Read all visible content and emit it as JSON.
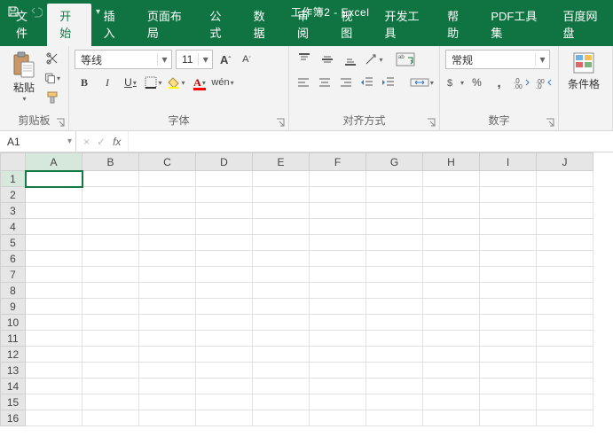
{
  "title": "工作簿2 - Excel",
  "tabs": [
    "文件",
    "开始",
    "插入",
    "页面布局",
    "公式",
    "数据",
    "审阅",
    "视图",
    "开发工具",
    "帮助",
    "PDF工具集",
    "百度网盘"
  ],
  "activeTabIndex": 1,
  "clipboard": {
    "paste": "粘贴",
    "group": "剪贴板"
  },
  "font": {
    "name": "等线",
    "size": "11",
    "group": "字体",
    "bold": "B",
    "italic": "I",
    "underline": "U"
  },
  "align": {
    "group": "对齐方式",
    "wrap": "ab"
  },
  "number": {
    "format": "常规",
    "group": "数字"
  },
  "styles": {
    "cond": "条件格"
  },
  "cellRef": "A1",
  "fx": "fx",
  "columns": [
    "A",
    "B",
    "C",
    "D",
    "E",
    "F",
    "G",
    "H",
    "I",
    "J"
  ],
  "rows": [
    "1",
    "2",
    "3",
    "4",
    "5",
    "6",
    "7",
    "8",
    "9",
    "10",
    "11",
    "12",
    "13",
    "14",
    "15",
    "16"
  ],
  "increaseFont": "A",
  "decreaseFont": "A"
}
